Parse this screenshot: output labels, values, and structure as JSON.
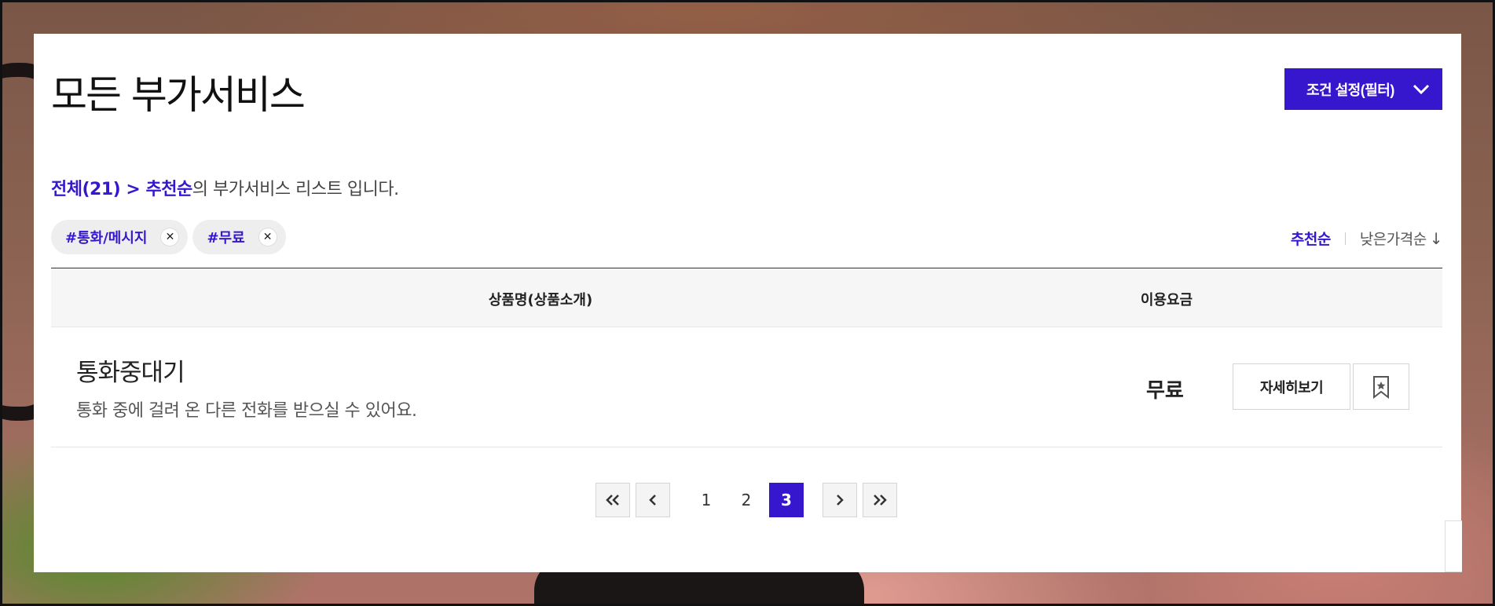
{
  "header": {
    "title": "모든 부가서비스",
    "filter_button": "조건 설정(필터)"
  },
  "summary": {
    "category": "전체(21)",
    "separator": " > ",
    "sort": "추천순",
    "suffix": "의 부가서비스 리스트 입니다."
  },
  "tags": [
    {
      "label": "#통화/메시지"
    },
    {
      "label": "#무료"
    }
  ],
  "sort_options": {
    "active": "추천순",
    "inactive": "낮은가격순",
    "arrow": "↓"
  },
  "table": {
    "columns": [
      "상품명(상품소개)",
      "이용요금"
    ],
    "rows": [
      {
        "title": "통화중대기",
        "description": "통화 중에 걸려 온 다른 전화를 받으실 수 있어요.",
        "price": "무료",
        "detail_label": "자세히보기"
      }
    ]
  },
  "pagination": {
    "pages": [
      "1",
      "2",
      "3"
    ],
    "current": "3"
  },
  "colors": {
    "accent": "#3617cd"
  }
}
